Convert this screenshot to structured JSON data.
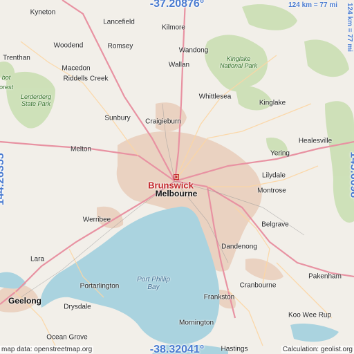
{
  "coordinates": {
    "top": "-37.20876°",
    "bottom": "-38.32041°",
    "left": "144.26355°",
    "right": "145.6698°"
  },
  "scale": {
    "top": "124 km = 77 mi",
    "side": "124 km = 77 mi"
  },
  "highlight_place": "Brunswick",
  "places": {
    "kyneton": "Kyneton",
    "lancefield": "Lancefield",
    "kilmore": "Kilmore",
    "woodend": "Woodend",
    "romsey": "Romsey",
    "wandong": "Wandong",
    "trenthan": "Trenthan",
    "macedon": "Macedon",
    "wallan": "Wallan",
    "riddells_creek": "Riddells Creek",
    "whittlesea": "Whittlesea",
    "kinglake": "Kinglake",
    "sunbury": "Sunbury",
    "craigieburn": "Craigieburn",
    "healesville": "Healesville",
    "melton": "Melton",
    "yering": "Yering",
    "lilydale": "Lilydale",
    "melbourne": "Melbourne",
    "montrose": "Montrose",
    "werribee": "Werribee",
    "belgrave": "Belgrave",
    "dandenong": "Dandenong",
    "lara": "Lara",
    "pakenham": "Pakenham",
    "portarlington": "Portarlington",
    "cranbourne": "Cranbourne",
    "geelong": "Geelong",
    "drysdale": "Drysdale",
    "frankston": "Frankston",
    "koo_wee_rup": "Koo Wee Rup",
    "mornington": "Mornington",
    "ocean_grove": "Ocean Grove",
    "hastings": "Hastings"
  },
  "parks": {
    "kinglake_np": "Kinglake National Park",
    "lerderderg": "Lerderderg State Park",
    "forest_fragment": "orest",
    "bot_fragment": "bot"
  },
  "water": {
    "port_phillip": "Port Phillip Bay"
  },
  "attribution": {
    "left": "map data: openstreetmap.org",
    "right": "Calculation: geolist.org"
  },
  "colors": {
    "land": "#f2efe9",
    "water": "#aad3df",
    "park": "#c8deb0",
    "urban": "#e8c9b4",
    "motorway": "#e892a2",
    "primary": "#fcd6a4",
    "coord_text": "#4a7bd0",
    "highlight": "#c2262a"
  }
}
